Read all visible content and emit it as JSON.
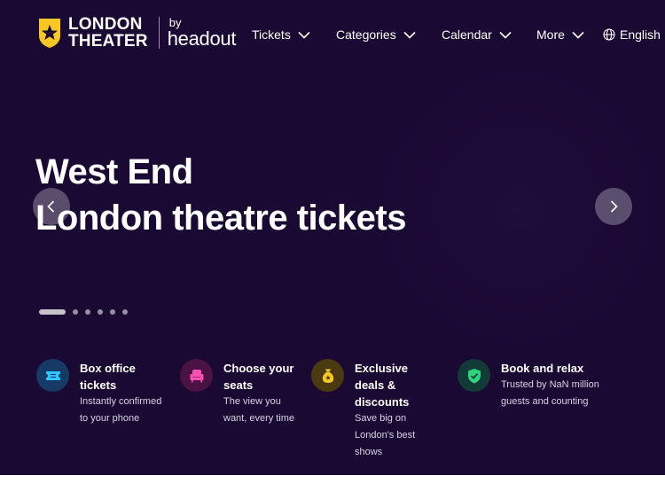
{
  "brand": {
    "logo_line1": "LONDON",
    "logo_line2": "THEATER",
    "partner_by": "by",
    "partner_name": "headout",
    "accent": "#f7c824"
  },
  "nav": {
    "items": [
      {
        "label": "Tickets"
      },
      {
        "label": "Categories"
      },
      {
        "label": "Calendar"
      },
      {
        "label": "More"
      }
    ],
    "language": "English"
  },
  "hero": {
    "title_line1": "West End",
    "title_line2": "London theatre tickets",
    "background": "#1a0933",
    "carousel_slides": 6,
    "carousel_active": 1
  },
  "features": [
    {
      "icon": "ticket-icon",
      "title": "Box office tickets",
      "description": "Instantly confirmed to your phone",
      "color": "#2ec6ff"
    },
    {
      "icon": "seat-icon",
      "title": "Choose your seats",
      "description": "The view you want, every time",
      "color": "#ff4fb3"
    },
    {
      "icon": "money-bag-icon",
      "title": "Exclusive deals & discounts",
      "description": "Save big on London's best shows",
      "color": "#f7c824"
    },
    {
      "icon": "shield-check-icon",
      "title": "Book and relax",
      "description": "Trusted by NaN million guests and counting",
      "color": "#2bd67b"
    }
  ]
}
